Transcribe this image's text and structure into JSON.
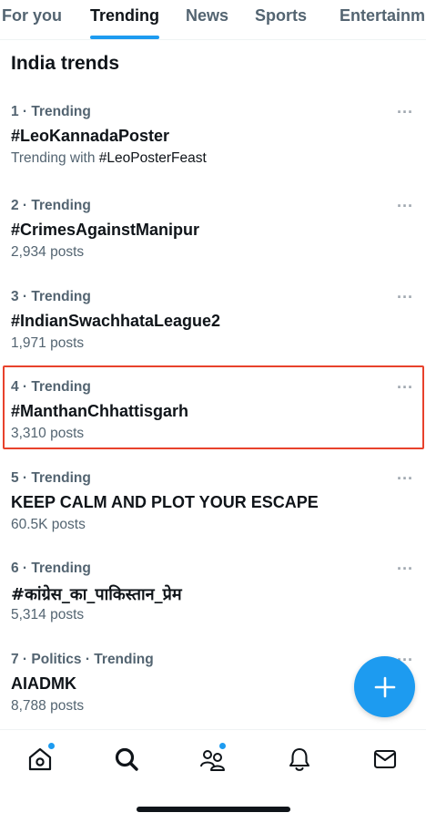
{
  "tabs": [
    {
      "label": "For you"
    },
    {
      "label": "Trending"
    },
    {
      "label": "News"
    },
    {
      "label": "Sports"
    },
    {
      "label": "Entertainm"
    }
  ],
  "active_tab": "Trending",
  "section_title": "India trends",
  "more_glyph": "···",
  "trends": [
    {
      "meta": "1 · Trending",
      "name": "#LeoKannadaPoster",
      "sub_prefix": "Trending with ",
      "sub_tag": "#LeoPosterFeast"
    },
    {
      "meta": "2 · Trending",
      "name": "#CrimesAgainstManipur",
      "sub": "2,934 posts"
    },
    {
      "meta": "3 · Trending",
      "name": "#IndianSwachhataLeague2",
      "sub": "1,971 posts"
    },
    {
      "meta": "4 · Trending",
      "name": "#ManthanChhattisgarh",
      "sub": "3,310 posts",
      "highlighted": true
    },
    {
      "meta": "5 · Trending",
      "name": "KEEP CALM AND PLOT YOUR ESCAPE",
      "sub": "60.5K posts"
    },
    {
      "meta": "6 · Trending",
      "name": "#कांग्रेस_का_पाकिस्तान_प्रेम",
      "sub": "5,314 posts"
    },
    {
      "meta": "7 · Politics · Trending",
      "name": "AIADMK",
      "sub": "8,788 posts"
    }
  ],
  "fab": {
    "icon": "plus-icon"
  },
  "bottom_nav": [
    {
      "icon": "home-icon",
      "badge": true
    },
    {
      "icon": "search-icon",
      "badge": false
    },
    {
      "icon": "communities-icon",
      "badge": true
    },
    {
      "icon": "notifications-bell-icon",
      "badge": false
    },
    {
      "icon": "messages-envelope-icon",
      "badge": false
    }
  ],
  "colors": {
    "accent": "#1d9bf0",
    "text_primary": "#0f1419",
    "text_secondary": "#536471",
    "highlight_border": "#e8422c"
  }
}
